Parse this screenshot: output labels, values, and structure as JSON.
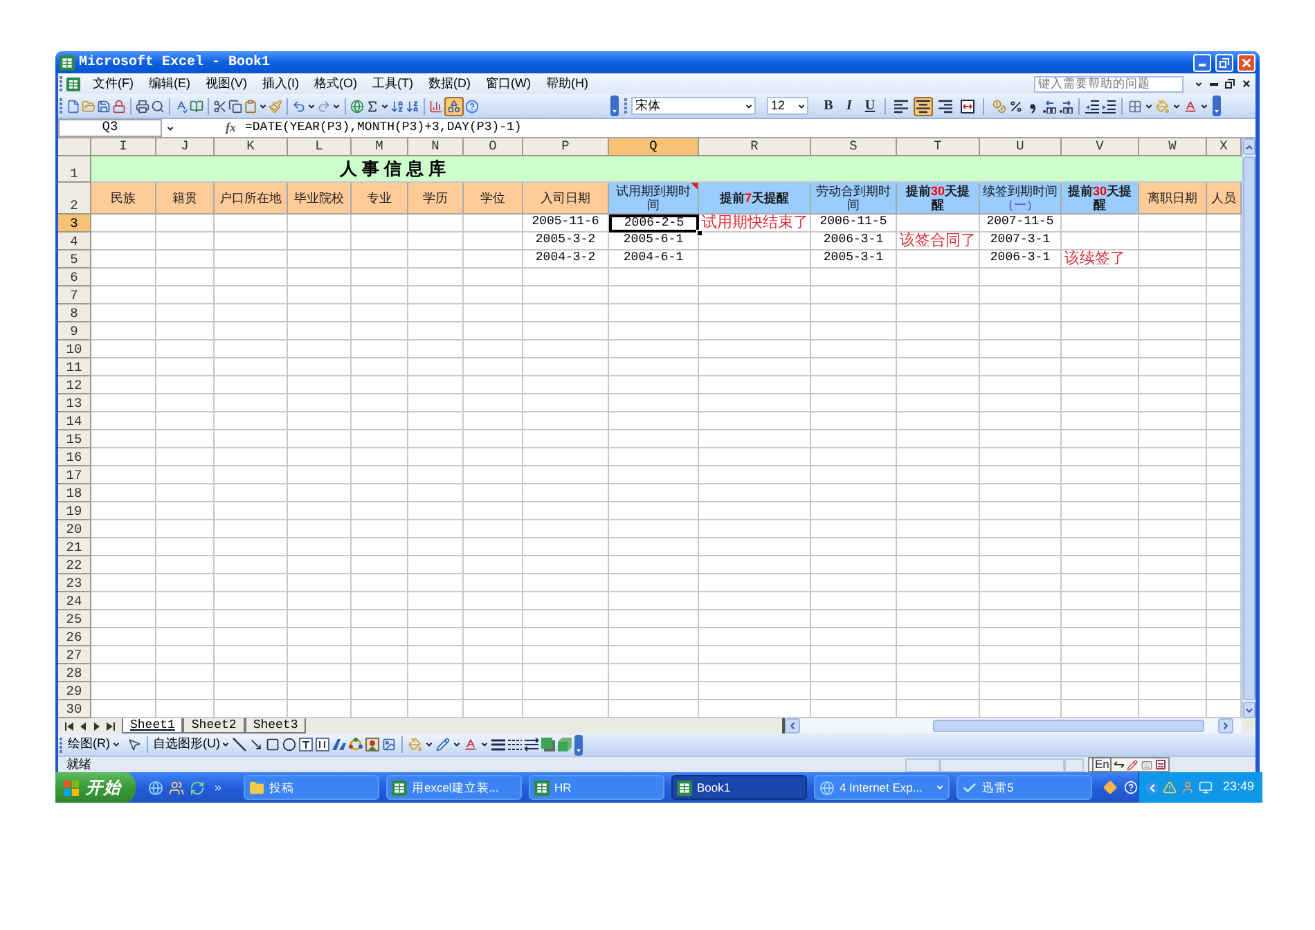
{
  "window": {
    "title": "Microsoft Excel - Book1"
  },
  "menu": {
    "items": [
      "文件(F)",
      "编辑(E)",
      "视图(V)",
      "插入(I)",
      "格式(O)",
      "工具(T)",
      "数据(D)",
      "窗口(W)",
      "帮助(H)"
    ],
    "help_placeholder": "键入需要帮助的问题"
  },
  "standard_toolbar": {
    "drawing": {
      "on": true
    }
  },
  "formatting": {
    "font": "宋体",
    "size": "12",
    "styles": [
      {
        "label": "B",
        "on": false
      },
      {
        "label": "I",
        "on": false
      },
      {
        "label": "U",
        "on": false
      }
    ],
    "alignment": [
      {
        "on": false
      },
      {
        "on": true
      },
      {
        "on": false
      },
      {
        "on": false
      }
    ]
  },
  "formula_bar": {
    "cell": "Q3",
    "function_label": "fx",
    "formula": "=DATE(YEAR(P3),MONTH(P3)+3,DAY(P3)-1)"
  },
  "sheet": {
    "columns": [
      {
        "letter": "I",
        "selected": false,
        "color": "#ffcc99",
        "bold": false,
        "comment": false,
        "header": [
          {
            "text": "民族"
          }
        ]
      },
      {
        "letter": "J",
        "selected": false,
        "color": "#ffcc99",
        "bold": false,
        "comment": false,
        "header": [
          {
            "text": "籍贯"
          }
        ]
      },
      {
        "letter": "K",
        "selected": false,
        "color": "#ffcc99",
        "bold": false,
        "comment": false,
        "header": [
          {
            "text": "户口所在地"
          }
        ]
      },
      {
        "letter": "L",
        "selected": false,
        "color": "#ffcc99",
        "bold": false,
        "comment": false,
        "header": [
          {
            "text": "毕业院校"
          }
        ]
      },
      {
        "letter": "M",
        "selected": false,
        "color": "#ffcc99",
        "bold": false,
        "comment": false,
        "header": [
          {
            "text": "专业"
          }
        ]
      },
      {
        "letter": "N",
        "selected": false,
        "color": "#ffcc99",
        "bold": false,
        "comment": false,
        "header": [
          {
            "text": "学历"
          }
        ]
      },
      {
        "letter": "O",
        "selected": false,
        "color": "#ffcc99",
        "bold": false,
        "comment": false,
        "header": [
          {
            "text": "学位"
          }
        ]
      },
      {
        "letter": "P",
        "selected": false,
        "color": "#ffcc99",
        "bold": false,
        "comment": false,
        "header": [
          {
            "text": "入司日期"
          }
        ]
      },
      {
        "letter": "Q",
        "selected": true,
        "color": "#99ccff",
        "bold": false,
        "comment": true,
        "header": [
          {
            "text": "试用期到期时间"
          }
        ]
      },
      {
        "letter": "R",
        "selected": false,
        "color": "#99ccff",
        "bold": true,
        "comment": false,
        "header": [
          {
            "text": "提前"
          },
          {
            "text": "7",
            "color": "#ff0000"
          },
          {
            "text": "天提醒"
          }
        ]
      },
      {
        "letter": "S",
        "selected": false,
        "color": "#99ccff",
        "bold": false,
        "comment": false,
        "header": [
          {
            "text": "劳动合到期时间"
          }
        ]
      },
      {
        "letter": "T",
        "selected": false,
        "color": "#99ccff",
        "bold": true,
        "comment": false,
        "header": [
          {
            "text": "提前"
          },
          {
            "text": "30",
            "color": "#ff0000"
          },
          {
            "text": "天提醒"
          }
        ]
      },
      {
        "letter": "U",
        "selected": false,
        "color": "#99ccff",
        "bold": false,
        "comment": false,
        "header": [
          {
            "text": "续签到期时间"
          },
          {
            "text": "（一）",
            "color": "#6633cc"
          }
        ]
      },
      {
        "letter": "V",
        "selected": false,
        "color": "#99ccff",
        "bold": true,
        "comment": false,
        "header": [
          {
            "text": "提前"
          },
          {
            "text": "30",
            "color": "#ff0000"
          },
          {
            "text": "天提醒"
          }
        ]
      },
      {
        "letter": "W",
        "selected": false,
        "color": "#ffcc99",
        "bold": false,
        "comment": false,
        "header": [
          {
            "text": "离职日期"
          }
        ]
      },
      {
        "letter": "X",
        "selected": false,
        "color": "#ffcc99",
        "bold": false,
        "comment": false,
        "header": [
          {
            "text": "人员"
          }
        ]
      }
    ],
    "rows": [
      {
        "kind": "title",
        "label": "1",
        "selected": false,
        "title": "人事信息库"
      },
      {
        "kind": "header",
        "label": "2",
        "selected": false
      },
      {
        "kind": "data",
        "label": "3",
        "selected": true,
        "cells": [
          null,
          null,
          null,
          null,
          null,
          null,
          null,
          {
            "kind": "date",
            "text": "2005-11-6"
          },
          {
            "kind": "date",
            "text": "2006-2-5"
          },
          {
            "kind": "note",
            "text": "试用期快结束了"
          },
          {
            "kind": "date",
            "text": "2006-11-5"
          },
          null,
          {
            "kind": "date",
            "text": "2007-11-5"
          },
          null,
          null,
          null
        ]
      },
      {
        "kind": "data",
        "label": "4",
        "selected": false,
        "cells": [
          null,
          null,
          null,
          null,
          null,
          null,
          null,
          {
            "kind": "date",
            "text": "2005-3-2"
          },
          {
            "kind": "date",
            "text": "2005-6-1"
          },
          null,
          {
            "kind": "date",
            "text": "2006-3-1"
          },
          {
            "kind": "note",
            "text": "该签合同了"
          },
          {
            "kind": "date",
            "text": "2007-3-1"
          },
          null,
          null,
          null
        ]
      },
      {
        "kind": "data",
        "label": "5",
        "selected": false,
        "cells": [
          null,
          null,
          null,
          null,
          null,
          null,
          null,
          {
            "kind": "date",
            "text": "2004-3-2"
          },
          {
            "kind": "date",
            "text": "2004-6-1"
          },
          null,
          {
            "kind": "date",
            "text": "2005-3-1"
          },
          null,
          {
            "kind": "date",
            "text": "2006-3-1"
          },
          {
            "kind": "note",
            "text": "该续签了"
          },
          null,
          null
        ]
      },
      {
        "kind": "data",
        "label": "6",
        "selected": false
      },
      {
        "kind": "data",
        "label": "7",
        "selected": false
      },
      {
        "kind": "data",
        "label": "8",
        "selected": false
      },
      {
        "kind": "data",
        "label": "9",
        "selected": false
      },
      {
        "kind": "data",
        "label": "10",
        "selected": false
      },
      {
        "kind": "data",
        "label": "11",
        "selected": false
      },
      {
        "kind": "data",
        "label": "12",
        "selected": false
      },
      {
        "kind": "data",
        "label": "13",
        "selected": false
      },
      {
        "kind": "data",
        "label": "14",
        "selected": false
      },
      {
        "kind": "data",
        "label": "15",
        "selected": false
      },
      {
        "kind": "data",
        "label": "16",
        "selected": false
      },
      {
        "kind": "data",
        "label": "17",
        "selected": false
      },
      {
        "kind": "data",
        "label": "18",
        "selected": false
      },
      {
        "kind": "data",
        "label": "19",
        "selected": false
      },
      {
        "kind": "data",
        "label": "20",
        "selected": false
      },
      {
        "kind": "data",
        "label": "21",
        "selected": false
      },
      {
        "kind": "data",
        "label": "22",
        "selected": false
      },
      {
        "kind": "data",
        "label": "23",
        "selected": false
      },
      {
        "kind": "data",
        "label": "24",
        "selected": false
      },
      {
        "kind": "data",
        "label": "25",
        "selected": false
      },
      {
        "kind": "data",
        "label": "26",
        "selected": false
      },
      {
        "kind": "data",
        "label": "27",
        "selected": false
      },
      {
        "kind": "data",
        "label": "28",
        "selected": false
      },
      {
        "kind": "data",
        "label": "29",
        "selected": false
      },
      {
        "kind": "data",
        "label": "30",
        "selected": false
      }
    ]
  },
  "sheet_tabs": [
    {
      "label": "Sheet1",
      "selected": true
    },
    {
      "label": "Sheet2",
      "selected": false
    },
    {
      "label": "Sheet3",
      "selected": false
    }
  ],
  "drawing_toolbar": {
    "draw_menu": "绘图(R)",
    "autoshapes_menu": "自选图形(U)"
  },
  "status_bar": {
    "text": "就绪",
    "language": "En"
  },
  "taskbar": {
    "start": "开始",
    "tasks": [
      {
        "kind": "folder",
        "label": "投稿",
        "selected": false,
        "grouped": false
      },
      {
        "kind": "document",
        "label": "用excel建立装...",
        "selected": false,
        "grouped": false
      },
      {
        "kind": "document",
        "label": "HR",
        "selected": false,
        "grouped": false
      },
      {
        "kind": "document",
        "label": "Book1",
        "selected": true,
        "grouped": false
      },
      {
        "kind": "browser",
        "label": "4 Internet Exp...",
        "selected": false,
        "grouped": true
      },
      {
        "kind": "download",
        "label": "迅雷5",
        "selected": false,
        "grouped": false
      }
    ],
    "clock": "23:49"
  }
}
